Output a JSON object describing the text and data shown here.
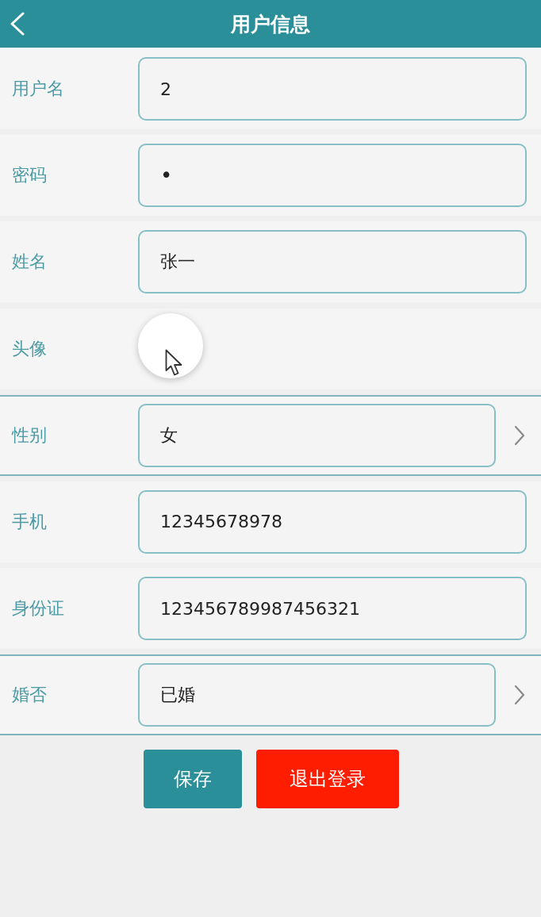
{
  "header": {
    "title": "用户信息"
  },
  "fields": [
    {
      "kind": "text",
      "label": "用户名",
      "value": "2"
    },
    {
      "kind": "password",
      "label": "密码",
      "value": "•"
    },
    {
      "kind": "text",
      "label": "姓名",
      "value": "张一"
    },
    {
      "kind": "avatar",
      "label": "头像"
    },
    {
      "kind": "select",
      "label": "性别",
      "value": "女"
    },
    {
      "kind": "text",
      "label": "手机",
      "value": "12345678978"
    },
    {
      "kind": "text",
      "label": "身份证",
      "value": "123456789987456321"
    },
    {
      "kind": "select",
      "label": "婚否",
      "value": "已婚"
    }
  ],
  "buttons": [
    {
      "kind": "primary",
      "label": "保存"
    },
    {
      "kind": "danger",
      "label": "退出登录"
    }
  ]
}
